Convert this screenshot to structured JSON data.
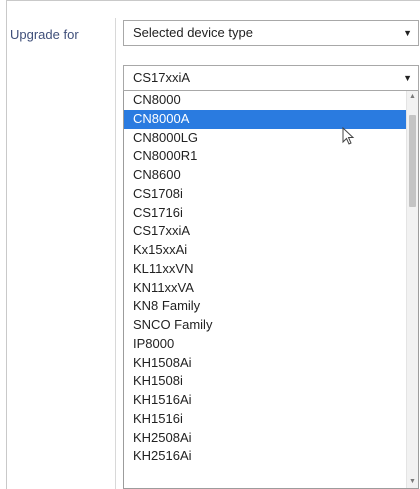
{
  "form": {
    "upgrade_label": "Upgrade for",
    "upgrade_select_value": "Selected device type",
    "device_select_value": "CS17xxiA"
  },
  "device_list": {
    "selected_index": 1,
    "options": [
      "CN8000",
      "CN8000A",
      "CN8000LG",
      "CN8000R1",
      "CN8600",
      "CS1708i",
      "CS1716i",
      "CS17xxiA",
      "Kx15xxAi",
      "KL11xxVN",
      "KN11xxVA",
      "KN8 Family",
      "SNCO Family",
      "IP8000",
      "KH1508Ai",
      "KH1508i",
      "KH1516Ai",
      "KH1516i",
      "KH2508Ai",
      "KH2516Ai"
    ]
  },
  "icons": {
    "dropdown_arrow": "▼",
    "scroll_up": "▲",
    "scroll_down": "▼"
  }
}
